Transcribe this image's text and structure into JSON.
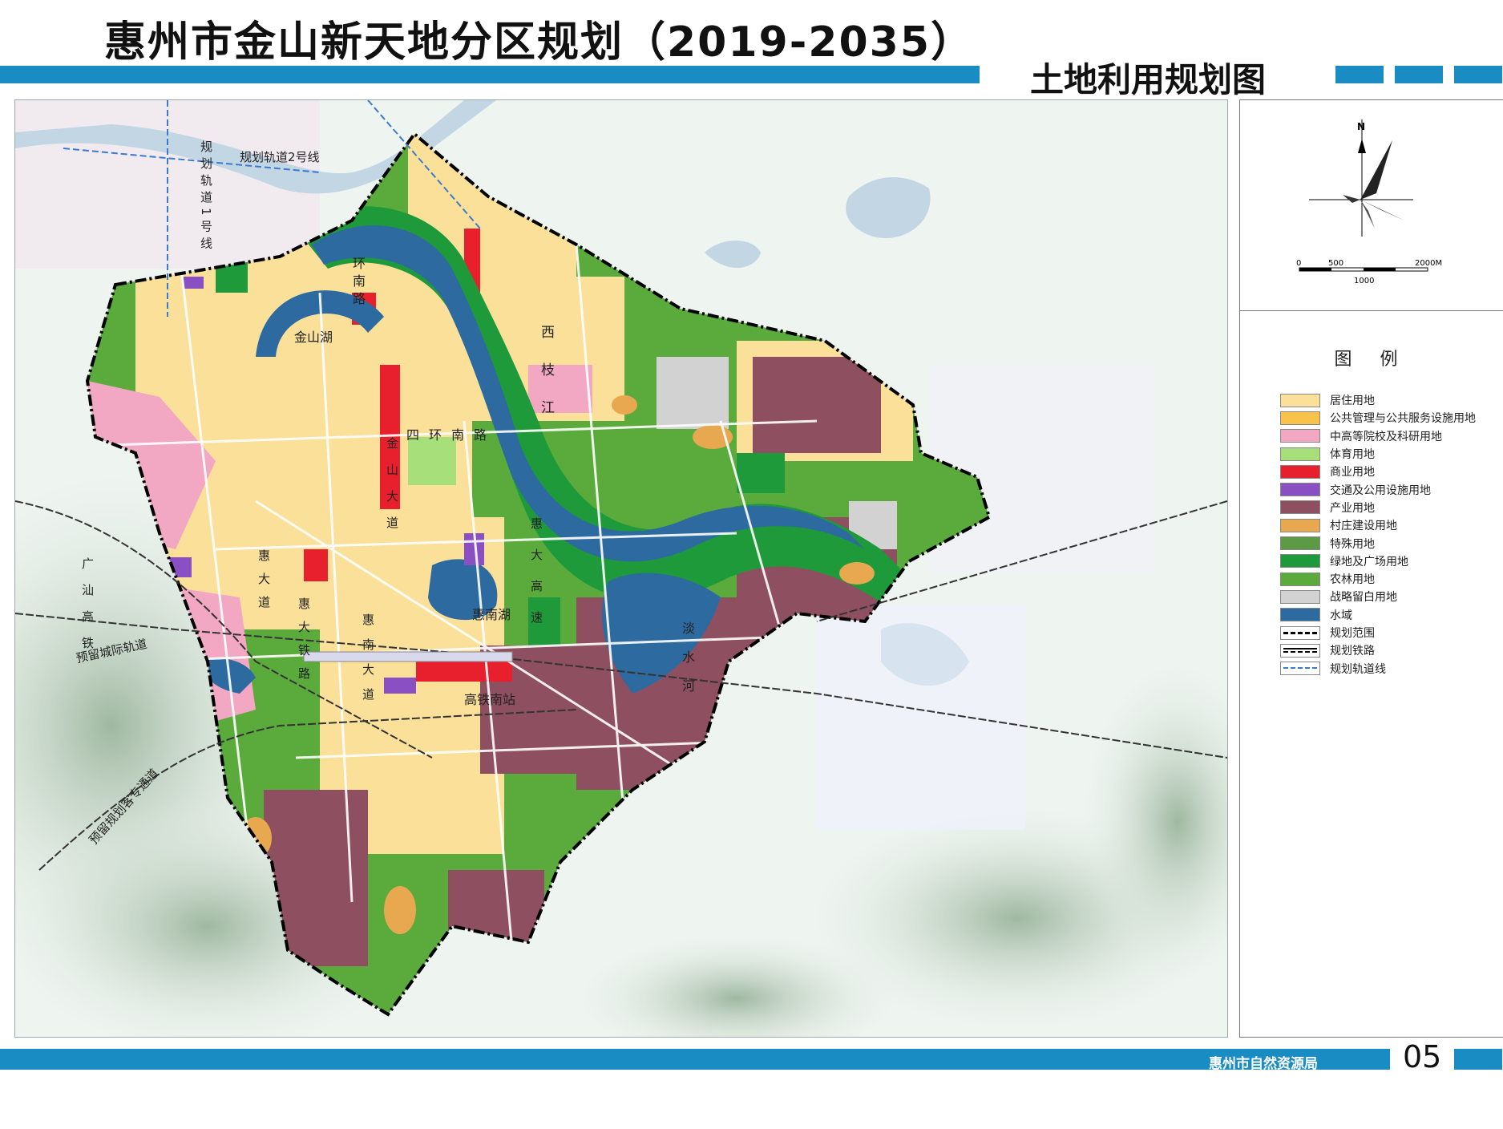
{
  "header": {
    "title": "惠州市金山新天地分区规划（2019-2035）",
    "subtitle": "土地利用规划图"
  },
  "compass": {
    "north_label": "N"
  },
  "scale_bar": {
    "labels": [
      "0",
      "500",
      "2000M",
      "1000"
    ]
  },
  "legend": {
    "title": "图 例",
    "items": [
      {
        "label": "居住用地",
        "color": "#fbe09a",
        "type": "fill"
      },
      {
        "label": "公共管理与公共服务设施用地",
        "color": "#f9c24a",
        "type": "fill"
      },
      {
        "label": "中高等院校及科研用地",
        "color": "#f2a7c2",
        "type": "fill"
      },
      {
        "label": "体育用地",
        "color": "#a7e07a",
        "type": "fill"
      },
      {
        "label": "商业用地",
        "color": "#e8202e",
        "type": "fill"
      },
      {
        "label": "交通及公用设施用地",
        "color": "#8a4fc3",
        "type": "fill"
      },
      {
        "label": "产业用地",
        "color": "#8e5060",
        "type": "fill"
      },
      {
        "label": "村庄建设用地",
        "color": "#e8a850",
        "type": "fill"
      },
      {
        "label": "特殊用地",
        "color": "#5c9a46",
        "type": "fill"
      },
      {
        "label": "绿地及广场用地",
        "color": "#1f9a3a",
        "type": "fill"
      },
      {
        "label": "农林用地",
        "color": "#5aab3c",
        "type": "fill"
      },
      {
        "label": "战略留白用地",
        "color": "#d2d2d2",
        "type": "fill"
      },
      {
        "label": "水域",
        "color": "#2d6aa0",
        "type": "fill"
      },
      {
        "label": "规划范围",
        "color": "#000000",
        "type": "dashdot"
      },
      {
        "label": "规划铁路",
        "color": "#000000",
        "type": "rail"
      },
      {
        "label": "规划轨道线",
        "color": "#3a7ad0",
        "type": "dash"
      }
    ]
  },
  "map_labels": {
    "metro1": "规划轨道1号线",
    "metro2": "规划轨道2号线",
    "huannan": "环南路",
    "jinshanhu": "金山湖",
    "xizhijiang": "西枝江",
    "sihuannan": "四环南路",
    "jinshan_rd": "金山大道",
    "huidadao": "惠大道",
    "huida_rail": "惠大铁路",
    "huinandadao": "惠南大道",
    "huinanhu": "惠南湖",
    "huidagaosu": "惠大高速",
    "danshuihe": "淡水河",
    "gaotie_station": "高铁南站",
    "guangshan": "广汕高铁",
    "intercity": "预留城际轨道",
    "passenger": "预留规划客专通道"
  },
  "footer": {
    "agency": "惠州市自然资源局",
    "page": "05"
  }
}
